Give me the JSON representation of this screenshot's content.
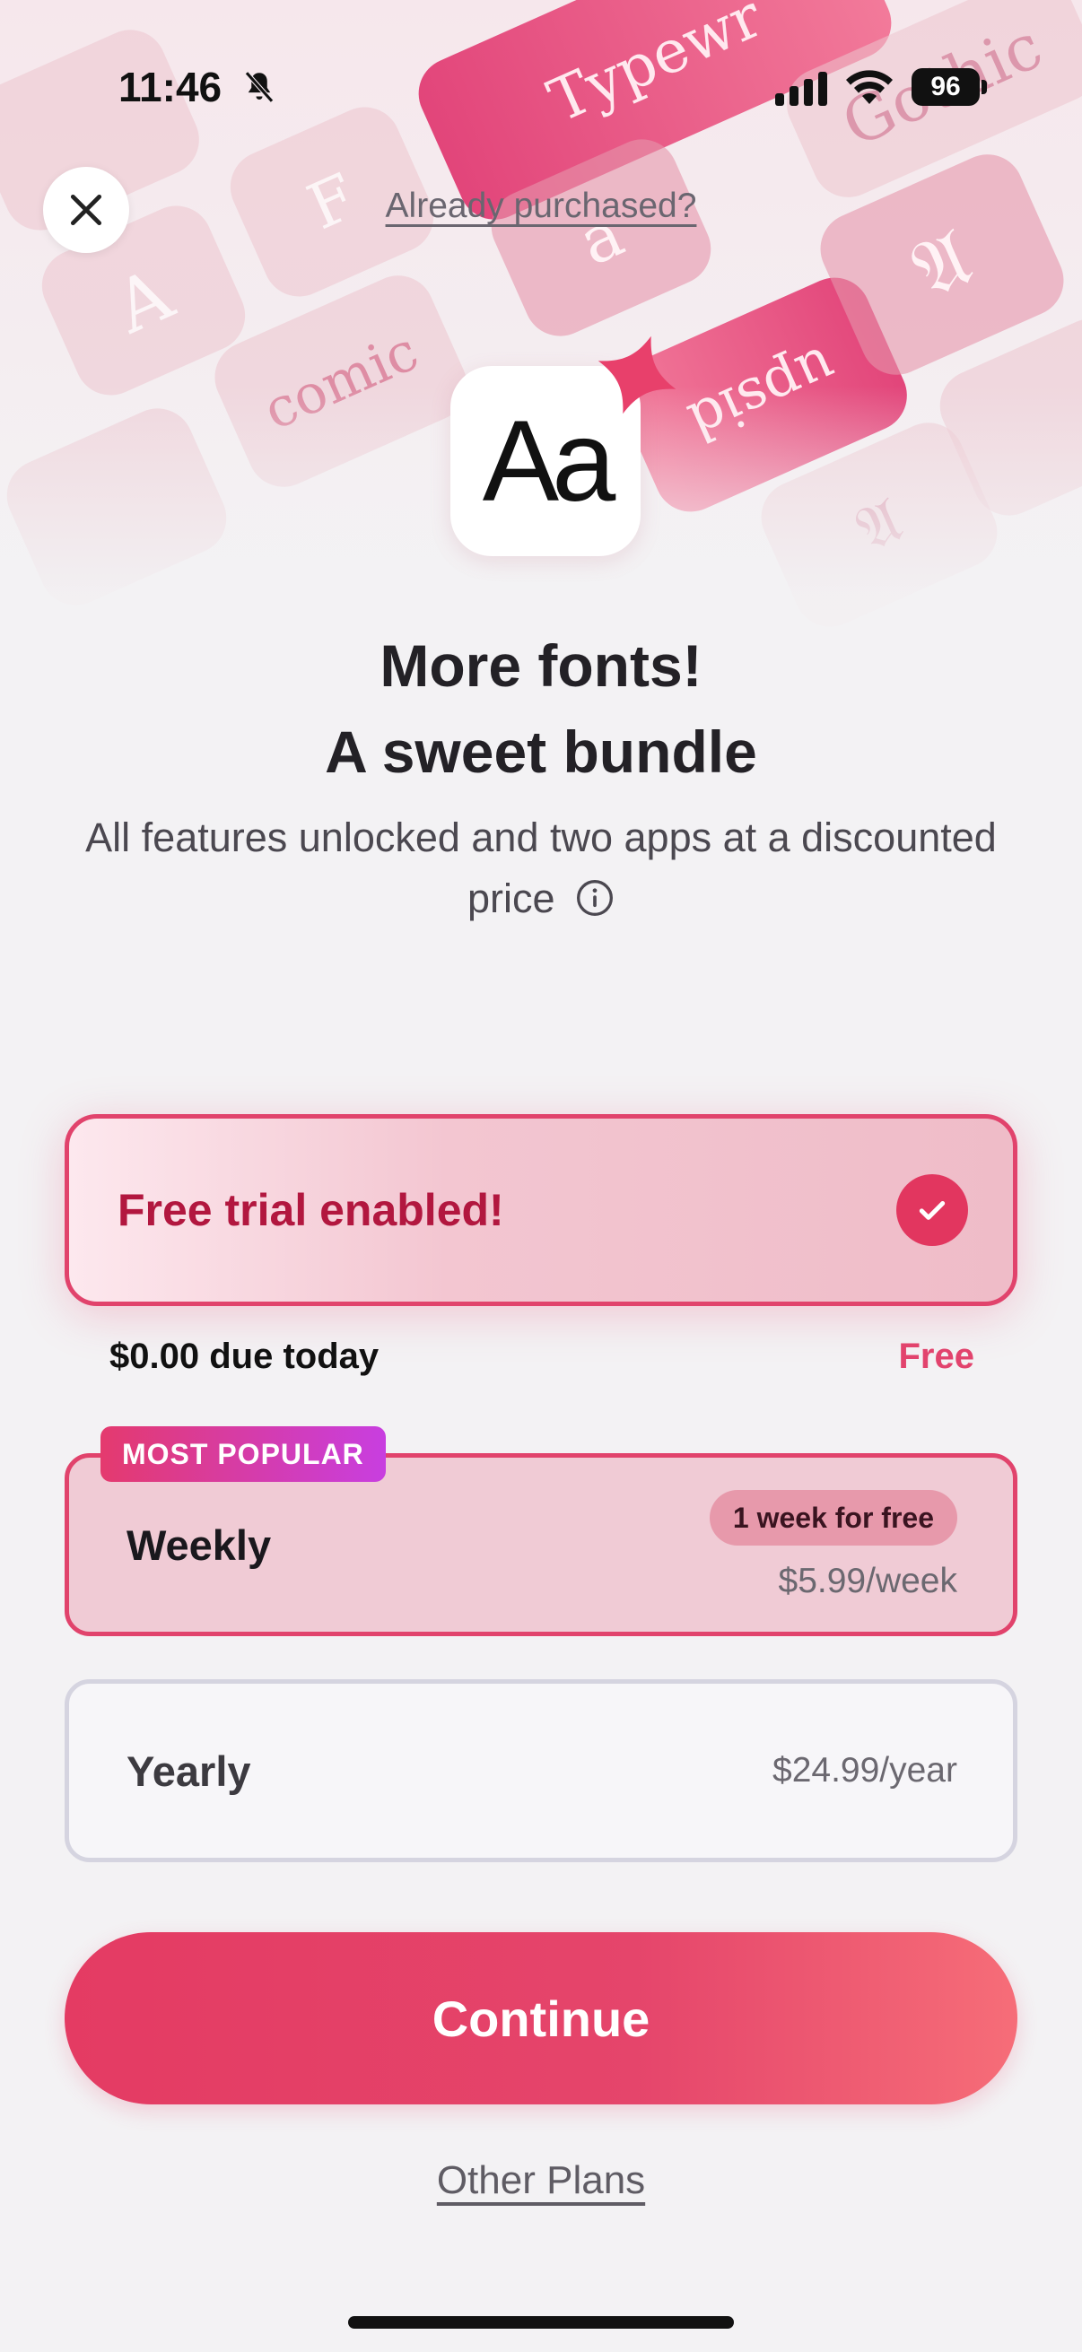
{
  "status_bar": {
    "time": "11:46",
    "battery": "96"
  },
  "header": {
    "already_purchased": "Already purchased?"
  },
  "hero": {
    "app_icon_text": "Aa",
    "tiles": [
      "Typewr",
      "Gothic",
      "comic",
      "upsid",
      "A",
      "a",
      "F"
    ]
  },
  "headline": {
    "line1": "More fonts!",
    "line2": "A sweet bundle"
  },
  "subtitle": "All features unlocked and two apps at a discounted price",
  "trial": {
    "label": "Free trial enabled!",
    "due_text": "$0.00 due today",
    "free_text": "Free"
  },
  "plans": [
    {
      "badge": "MOST POPULAR",
      "name": "Weekly",
      "trial_badge": "1 week for free",
      "price": "$5.99/week",
      "selected": true
    },
    {
      "name": "Yearly",
      "price": "$24.99/year",
      "selected": false
    }
  ],
  "actions": {
    "continue": "Continue",
    "other_plans": "Other Plans"
  },
  "colors": {
    "accent": "#e2436d",
    "background": "#f3f2f4"
  }
}
